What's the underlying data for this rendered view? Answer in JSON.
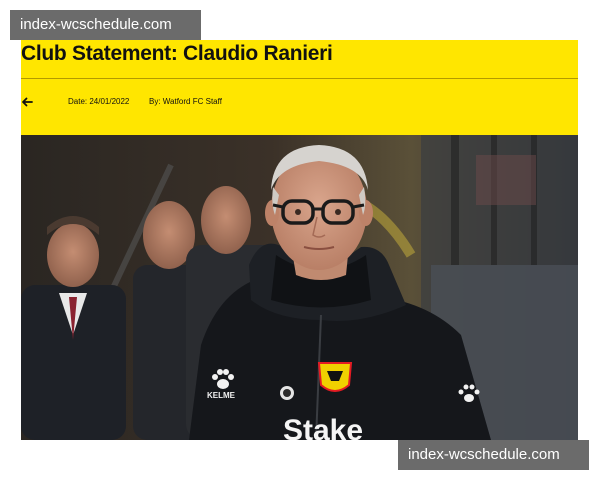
{
  "article": {
    "title": "Club Statement: Claudio Ranieri",
    "date": "Date: 24/01/2022",
    "author": "By: Watford FC Staff"
  },
  "icons": {
    "back": "arrow-left-icon"
  },
  "watermarks": {
    "top_left": "index-wcschedule.com",
    "bottom_right": "index-wcschedule.com"
  },
  "colors": {
    "header_background": "#ffe600",
    "text": "#111111",
    "watermark_background": "#6b6b6b",
    "watermark_text": "#ffffff"
  },
  "photo_text": {
    "kit_brand": "KELME",
    "sponsor": "Stake"
  }
}
